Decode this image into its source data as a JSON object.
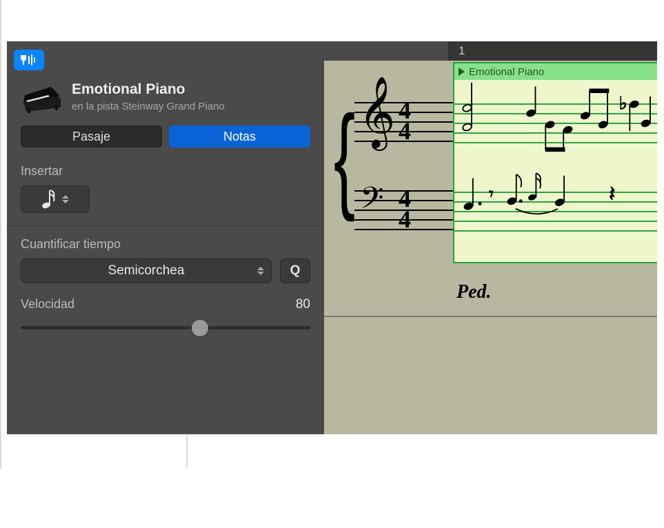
{
  "inspector": {
    "region_name": "Emotional Piano",
    "track_line": "en la pista Steinway Grand Piano",
    "tabs": {
      "region": "Pasaje",
      "notes": "Notas"
    },
    "insert_label": "Insertar",
    "quantize_label": "Cuantificar tiempo",
    "quantize_value": "Semicorchea",
    "q_button": "Q",
    "velocity_label": "Velocidad",
    "velocity_value": "80",
    "velocity_percent": 62
  },
  "ruler": {
    "bar1": "1"
  },
  "region_header": {
    "title": "Emotional Piano"
  },
  "time_signature": {
    "num": "4",
    "den": "4"
  },
  "pedal_text": "Ped."
}
